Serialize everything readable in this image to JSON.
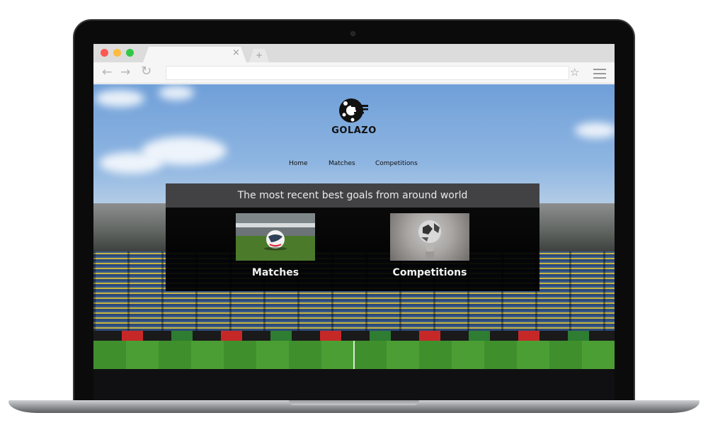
{
  "browser": {
    "tab_close": "×",
    "new_tab": "+",
    "back_glyph": "←",
    "forward_glyph": "→",
    "reload_glyph": "↻",
    "bookmark_glyph": "☆",
    "url": ""
  },
  "site": {
    "logo_text": "GOLAZO",
    "nav": [
      "Home",
      "Matches",
      "Competitions"
    ],
    "headline": "The most recent best goals from around world",
    "cards": [
      {
        "label": "Matches",
        "image": "soccer-ball-on-pitch"
      },
      {
        "label": "Competitions",
        "image": "soccer-trophy"
      }
    ]
  },
  "colors": {
    "traffic_red": "#fc5753",
    "traffic_yellow": "#fdbc40",
    "traffic_green": "#33c748",
    "panel_bg": "#000000",
    "panel_header_bg": "#464648",
    "logo": "#111111"
  }
}
